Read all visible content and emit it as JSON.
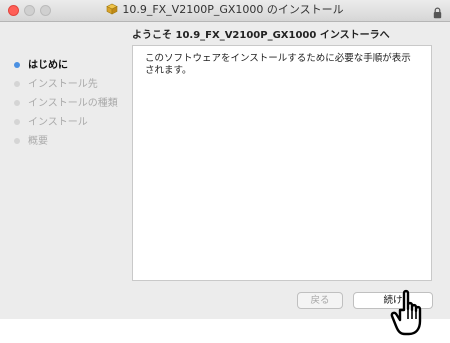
{
  "window": {
    "title": "10.9_FX_V2100P_GX1000 のインストール"
  },
  "main": {
    "heading": "ようこそ 10.9_FX_V2100P_GX1000 インストーラへ",
    "message": "このソフトウェアをインストールするために必要な手順が表示されます。"
  },
  "sidebar": {
    "steps": [
      {
        "label": "はじめに"
      },
      {
        "label": "インストール先"
      },
      {
        "label": "インストールの種類"
      },
      {
        "label": "インストール"
      },
      {
        "label": "概要"
      }
    ]
  },
  "buttons": {
    "back_label": "戻る",
    "continue_label": "続け"
  },
  "colors": {
    "active_step_dot": "#4a90e2",
    "close_button": "#ff5f57"
  },
  "icons": {
    "title_icon": "package-icon",
    "lock": "lock-icon",
    "cursor": "hand-pointer-cursor-icon"
  }
}
